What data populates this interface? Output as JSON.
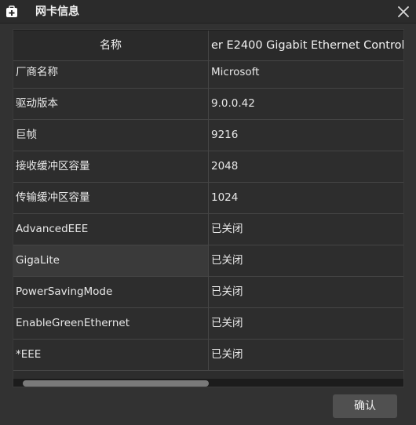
{
  "window": {
    "title": "网卡信息",
    "app_icon": "medkit-icon",
    "close_icon": "close-icon"
  },
  "table": {
    "header": {
      "name_col": "名称",
      "value_col": "er E2400 Gigabit Ethernet Control"
    },
    "rows": [
      {
        "name": "厂商名称",
        "value": "Microsoft"
      },
      {
        "name": "驱动版本",
        "value": "9.0.0.42"
      },
      {
        "name": "巨帧",
        "value": "9216"
      },
      {
        "name": "接收缓冲区容量",
        "value": "2048"
      },
      {
        "name": "传输缓冲区容量",
        "value": "1024"
      },
      {
        "name": "AdvancedEEE",
        "value": "已关闭"
      },
      {
        "name": "GigaLite",
        "value": "已关闭"
      },
      {
        "name": "PowerSavingMode",
        "value": "已关闭"
      },
      {
        "name": "EnableGreenEthernet",
        "value": "已关闭"
      },
      {
        "name": "*EEE",
        "value": "已关闭"
      }
    ]
  },
  "footer": {
    "ok_label": "确认"
  }
}
